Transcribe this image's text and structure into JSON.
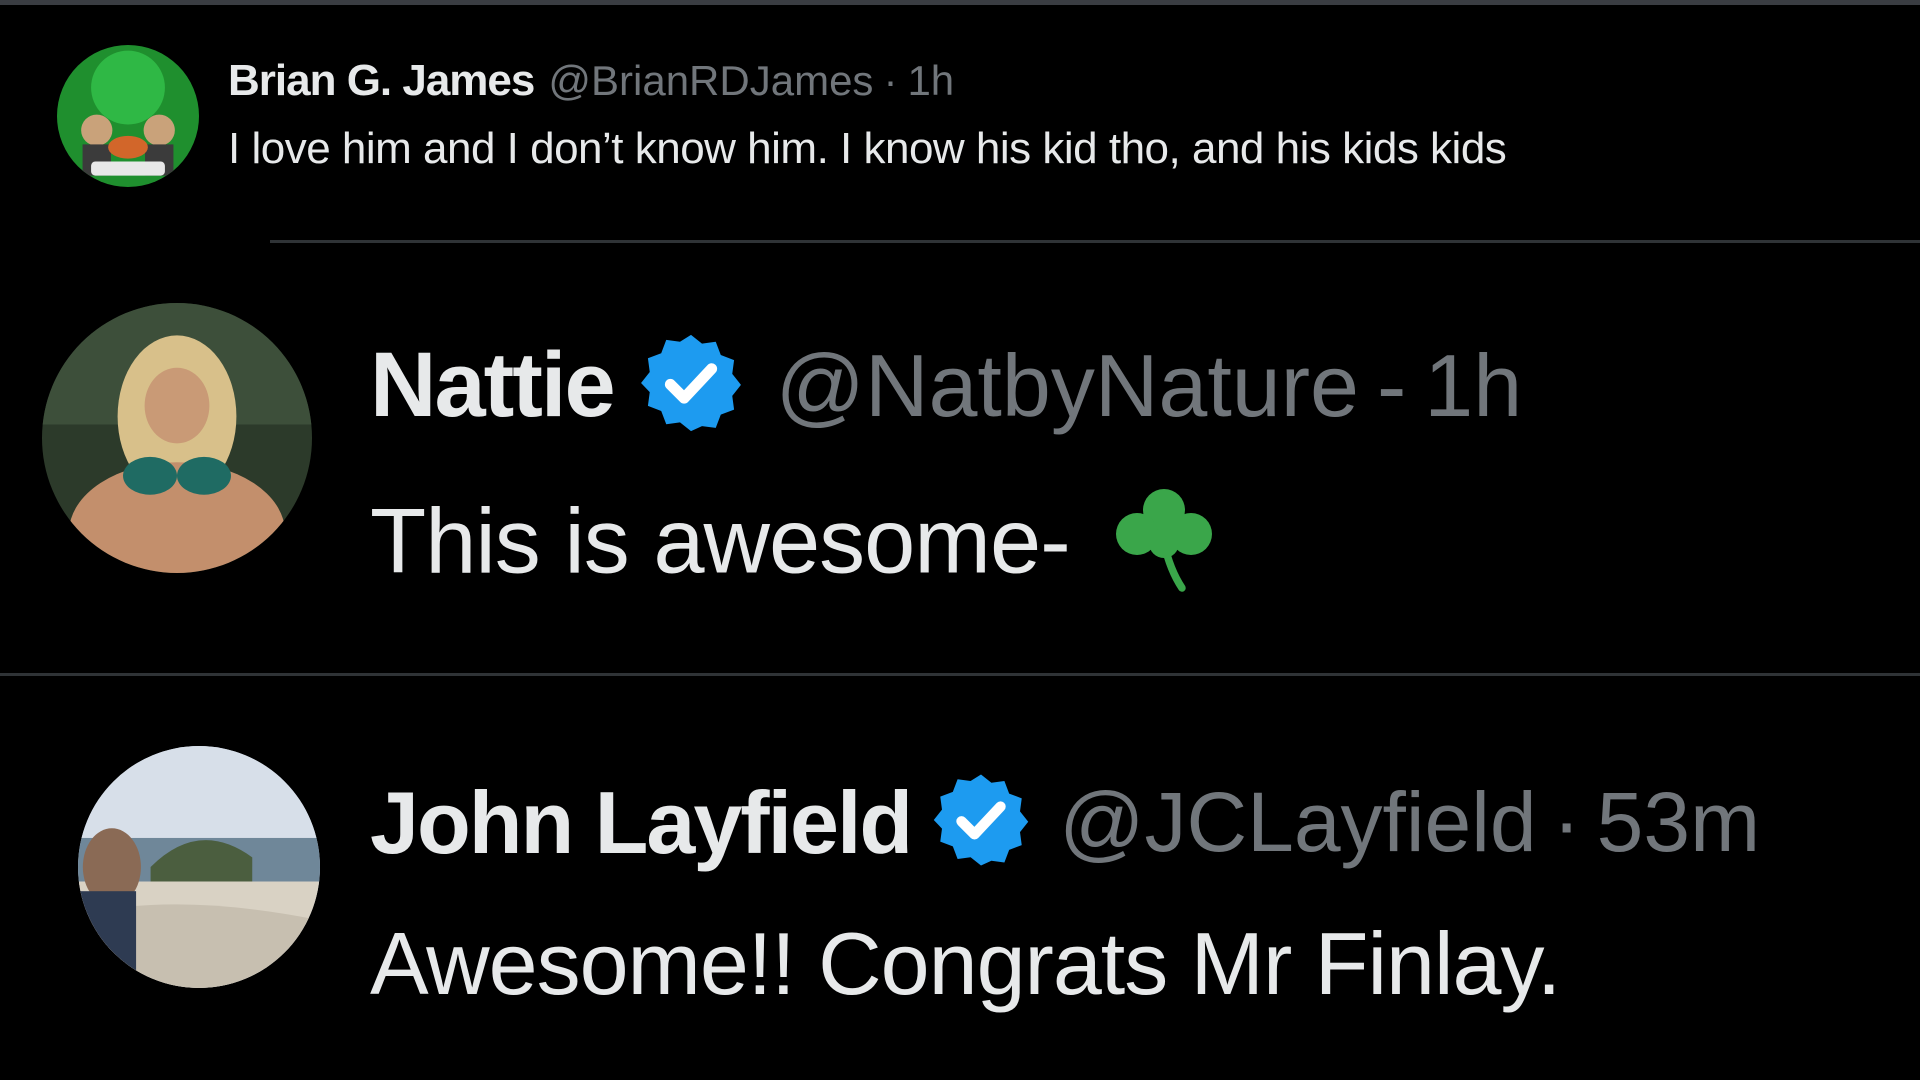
{
  "colors": {
    "background": "#000000",
    "primary_text": "#e7e9ea",
    "secondary_text": "#71767b",
    "verified_badge": "#1d9bf0",
    "divider": "#2f3336",
    "shamrock": "#3aa64a"
  },
  "replies": [
    {
      "display_name": "Brian G. James",
      "handle": "@BrianRDJames",
      "separator": "·",
      "time": "1h",
      "text": "I love him and I don’t know him. I know his kid tho, and his kids kids",
      "verified": false,
      "avatar_icon": "green-logo-avatar"
    },
    {
      "display_name": "Nattie",
      "handle": "@NatbyNature",
      "separator": "-",
      "time": "1h",
      "text": "This is awesome-",
      "emoji": "shamrock-icon",
      "verified": true,
      "avatar_icon": "profile-photo-avatar"
    },
    {
      "display_name": "John Layfield",
      "handle": "@JCLayfield",
      "separator": "·",
      "time": "53m",
      "text": "Awesome!! Congrats Mr Finlay.",
      "verified": true,
      "avatar_icon": "beach-photo-avatar"
    }
  ]
}
